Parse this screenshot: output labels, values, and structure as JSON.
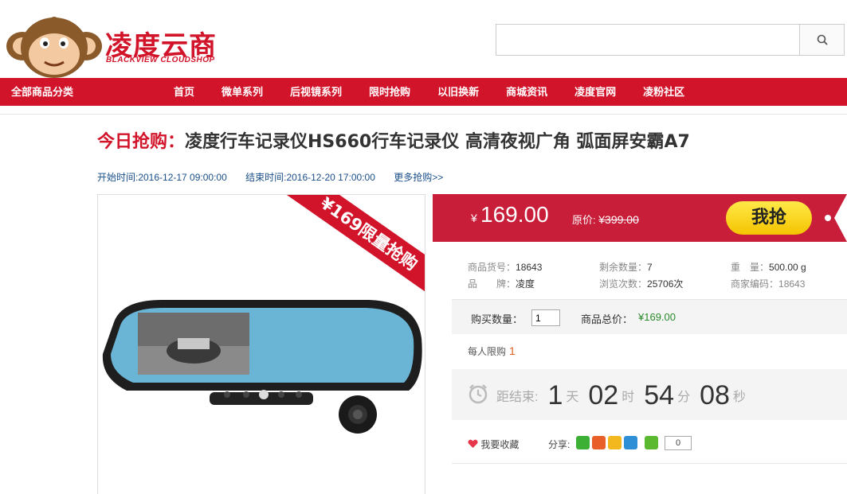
{
  "brand": {
    "name_cn": "凌度云商",
    "name_en": "BLACKVIEW CLOUDSHOP"
  },
  "search": {
    "placeholder": "",
    "value": ""
  },
  "nav": {
    "all_categories": "全部商品分类",
    "items": [
      "首页",
      "微单系列",
      "后视镜系列",
      "限时抢购",
      "以旧换新",
      "商城资讯",
      "凌度官网",
      "凌粉社区"
    ]
  },
  "product": {
    "title_label": "今日抢购：",
    "title": "凌度行车记录仪HS660行车记录仪 高清夜视广角 弧面屏安霸A7",
    "start_time": "开始时间:2016-12-17 09:00:00",
    "end_time": "结束时间:2016-12-20 17:00:00",
    "more_link": "更多抢购>>",
    "ribbon": "¥169限量抢购"
  },
  "price": {
    "currency": "¥",
    "current": "169.00",
    "original_label": "原价:",
    "original": "¥399.00",
    "buy_label": "我抢"
  },
  "info": {
    "rows": [
      [
        {
          "k": "商品货号：",
          "v": "18643"
        },
        {
          "k": "剩余数量：",
          "v": "7"
        },
        {
          "k": "重　量：",
          "v": "500.00 g"
        }
      ],
      [
        {
          "k": "品　　牌：",
          "v": "凌度"
        },
        {
          "k": "浏览次数：",
          "v": "25706次"
        },
        {
          "k": "商家编码：",
          "v": "18643"
        }
      ]
    ]
  },
  "purchase": {
    "qty_label": "购买数量：",
    "qty_value": "1",
    "total_label": "商品总价：",
    "total_value": "¥169.00",
    "limit_label": "每人限购",
    "limit_value": "1"
  },
  "countdown": {
    "label": "距结束:",
    "days": "1",
    "days_unit": "天",
    "hours": "02",
    "hours_unit": "时",
    "minutes": "54",
    "minutes_unit": "分",
    "seconds": "08",
    "seconds_unit": "秒"
  },
  "share": {
    "fav_label": "我要收藏",
    "share_label": "分享:",
    "count": "0",
    "icons": [
      "wechat-icon",
      "weibo-icon",
      "qzone-icon",
      "tencent-weibo-icon",
      "more-share-icon"
    ]
  },
  "colors": {
    "brand_red": "#d2142a",
    "price_bar": "#c81e3a",
    "buy_yellow": "#f4c400"
  }
}
